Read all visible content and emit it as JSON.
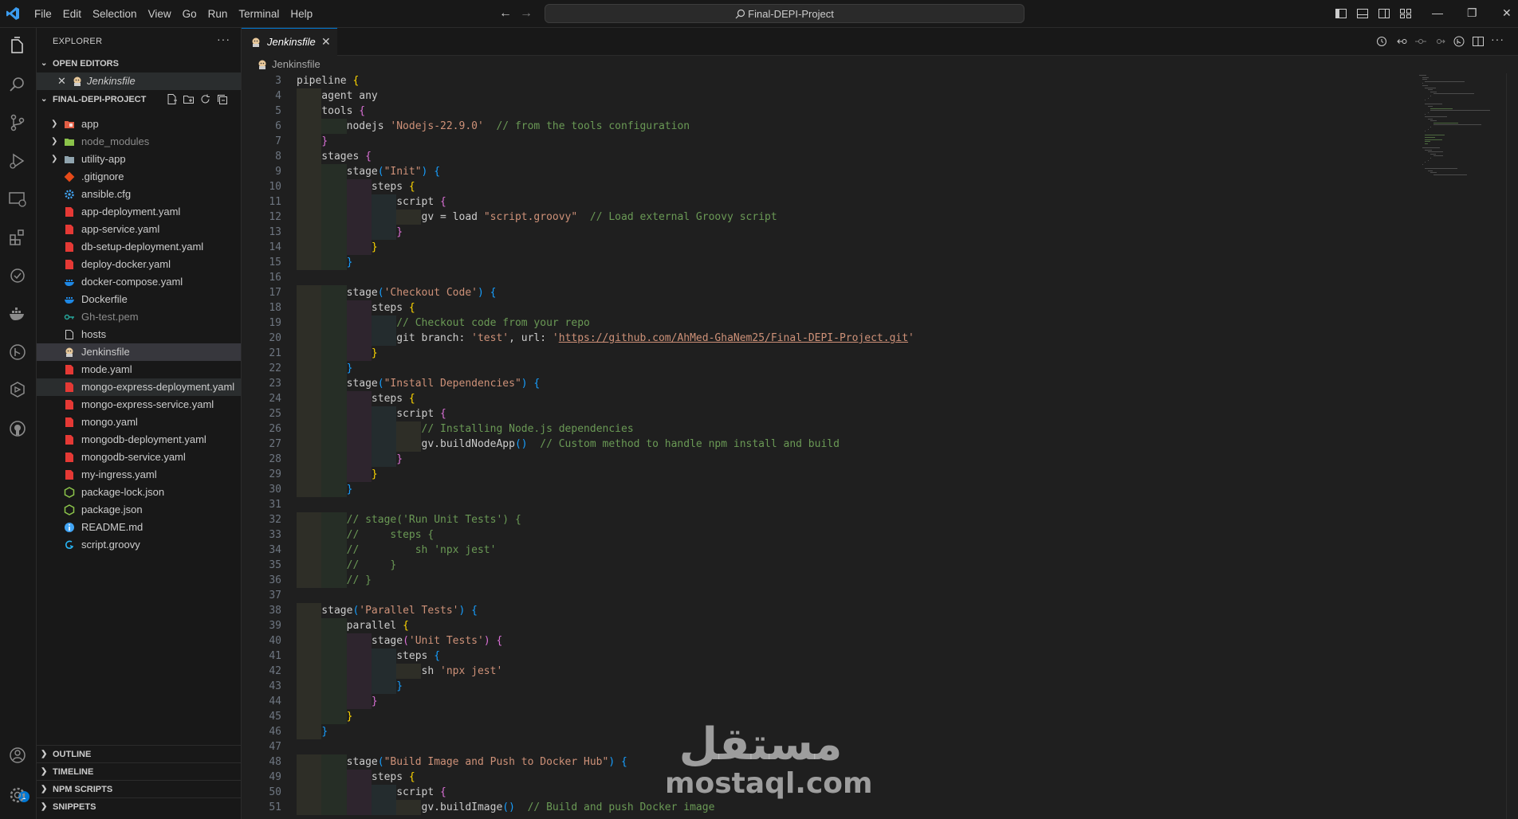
{
  "titlebar": {
    "menu": [
      "File",
      "Edit",
      "Selection",
      "View",
      "Go",
      "Run",
      "Terminal",
      "Help"
    ],
    "search_text": "Final-DEPI-Project",
    "accent": "#0078d4"
  },
  "sidebar": {
    "title": "EXPLORER",
    "open_editors_label": "OPEN EDITORS",
    "open_editor_file": "Jenkinsfile",
    "project_label": "FINAL-DEPI-PROJECT",
    "folders": [
      "app",
      "node_modules",
      "utility-app"
    ],
    "files": [
      {
        "name": ".gitignore",
        "icon": "git-icon"
      },
      {
        "name": "ansible.cfg",
        "icon": "gear-icon"
      },
      {
        "name": "app-deployment.yaml",
        "icon": "yaml-icon"
      },
      {
        "name": "app-service.yaml",
        "icon": "yaml-icon"
      },
      {
        "name": "db-setup-deployment.yaml",
        "icon": "yaml-icon"
      },
      {
        "name": "deploy-docker.yaml",
        "icon": "yaml-icon"
      },
      {
        "name": "docker-compose.yaml",
        "icon": "docker-icon"
      },
      {
        "name": "Dockerfile",
        "icon": "docker-icon"
      },
      {
        "name": "Gh-test.pem",
        "icon": "key-icon"
      },
      {
        "name": "hosts",
        "icon": "file-icon"
      },
      {
        "name": "Jenkinsfile",
        "icon": "jenkins-icon"
      },
      {
        "name": "mode.yaml",
        "icon": "yaml-icon"
      },
      {
        "name": "mongo-express-deployment.yaml",
        "icon": "yaml-icon"
      },
      {
        "name": "mongo-express-service.yaml",
        "icon": "yaml-icon"
      },
      {
        "name": "mongo.yaml",
        "icon": "yaml-icon"
      },
      {
        "name": "mongodb-deployment.yaml",
        "icon": "yaml-icon"
      },
      {
        "name": "mongodb-service.yaml",
        "icon": "yaml-icon"
      },
      {
        "name": "my-ingress.yaml",
        "icon": "yaml-icon"
      },
      {
        "name": "package-lock.json",
        "icon": "node-icon"
      },
      {
        "name": "package.json",
        "icon": "node-icon"
      },
      {
        "name": "README.md",
        "icon": "info-icon"
      },
      {
        "name": "script.groovy",
        "icon": "groovy-icon"
      }
    ],
    "bottom_sections": [
      "OUTLINE",
      "TIMELINE",
      "NPM SCRIPTS",
      "SNIPPETS"
    ],
    "accounts_badge": "1"
  },
  "editor": {
    "tab_label": "Jenkinsfile",
    "breadcrumb": "Jenkinsfile",
    "line_numbers": [
      3,
      4,
      5,
      6,
      7,
      8,
      9,
      10,
      11,
      12,
      13,
      14,
      15,
      16,
      17,
      18,
      19,
      20,
      21,
      22,
      23,
      24,
      25,
      26,
      27,
      28,
      29,
      30,
      31,
      32,
      33,
      34,
      35,
      36,
      37,
      38,
      39,
      40,
      41,
      42,
      43,
      44,
      45,
      46,
      47,
      48,
      49,
      50,
      51
    ],
    "lines": [
      "pipeline {",
      "    agent any",
      "    tools {",
      "        nodejs 'Nodejs-22.9.0'  // from the tools configuration",
      "    }",
      "    stages {",
      "        stage(\"Init\") {",
      "            steps {",
      "                script {",
      "                    gv = load \"script.groovy\"  // Load external Groovy script",
      "                }",
      "            }",
      "        }",
      "",
      "        stage('Checkout Code') {",
      "            steps {",
      "                // Checkout code from your repo",
      "                git branch: 'test', url: 'https://github.com/AhMed-GhaNem25/Final-DEPI-Project.git'",
      "            }",
      "        }",
      "        stage(\"Install Dependencies\") {",
      "            steps {",
      "                script {",
      "                    // Installing Node.js dependencies",
      "                    gv.buildNodeApp()  // Custom method to handle npm install and build",
      "                }",
      "            }",
      "        }",
      "",
      "        // stage('Run Unit Tests') {",
      "        //     steps {",
      "        //         sh 'npx jest'",
      "        //     }",
      "        // }",
      "",
      "    stage('Parallel Tests') {",
      "        parallel {",
      "            stage('Unit Tests') {",
      "                steps {",
      "                    sh 'npx jest'",
      "                }",
      "            }",
      "        }",
      "    }",
      "",
      "        stage(\"Build Image and Push to Docker Hub\") {",
      "            steps {",
      "                script {",
      "                    gv.buildImage()  // Build and push Docker image"
    ]
  },
  "watermark": {
    "arabic": "مستقل",
    "latin": "mostaql.com"
  }
}
